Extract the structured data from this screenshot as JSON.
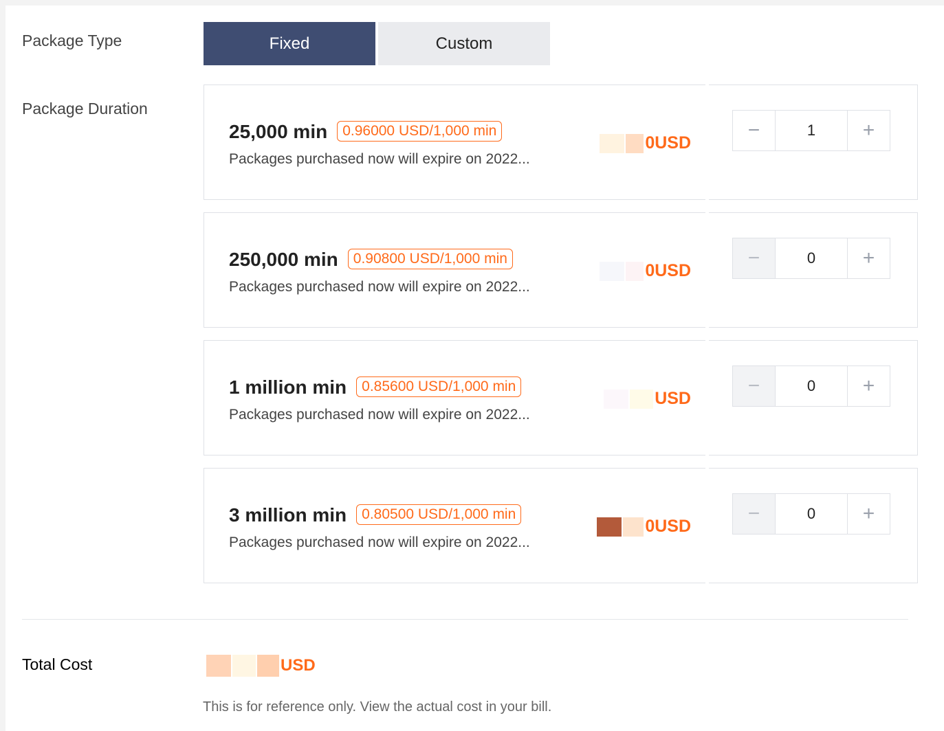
{
  "labels": {
    "package_type": "Package Type",
    "package_duration": "Package Duration",
    "total_cost": "Total Cost"
  },
  "package_type": {
    "options": [
      "Fixed",
      "Custom"
    ],
    "selected": "Fixed"
  },
  "packages": [
    {
      "name": "25,000 min",
      "unit_price": "0.96000 USD/1,000 min",
      "expire_text": "Packages purchased now will expire on 2022...",
      "cost_suffix": "0USD",
      "quantity": "1"
    },
    {
      "name": "250,000 min",
      "unit_price": "0.90800 USD/1,000 min",
      "expire_text": "Packages purchased now will expire on 2022...",
      "cost_suffix": "0USD",
      "quantity": "0"
    },
    {
      "name": "1 million min",
      "unit_price": "0.85600 USD/1,000 min",
      "expire_text": "Packages purchased now will expire on 2022...",
      "cost_suffix": "USD",
      "quantity": "0"
    },
    {
      "name": "3 million min",
      "unit_price": "0.80500 USD/1,000 min",
      "expire_text": "Packages purchased now will expire on 2022...",
      "cost_suffix": "0USD",
      "quantity": "0"
    }
  ],
  "stepper": {
    "decrement_symbol": "−",
    "increment_symbol": "+"
  },
  "total": {
    "cost_suffix": "USD",
    "note": "This is for reference only. View the actual cost in your bill."
  },
  "colors": {
    "accent": "#ff6a1a",
    "active_toggle": "#3f4d72"
  }
}
